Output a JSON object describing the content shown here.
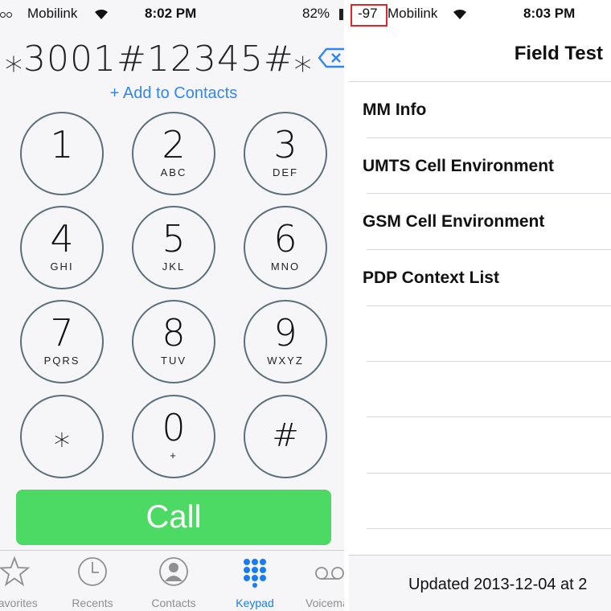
{
  "left_phone": {
    "status": {
      "carrier": "Mobilink",
      "time": "8:02 PM",
      "battery": "82%"
    },
    "dialed_number": "⁎3001#12345#⁎",
    "add_to_contacts": "+ Add to Contacts",
    "keys": [
      {
        "digit": "1",
        "letters": ""
      },
      {
        "digit": "2",
        "letters": "ABC"
      },
      {
        "digit": "3",
        "letters": "DEF"
      },
      {
        "digit": "4",
        "letters": "GHI"
      },
      {
        "digit": "5",
        "letters": "JKL"
      },
      {
        "digit": "6",
        "letters": "MNO"
      },
      {
        "digit": "7",
        "letters": "PQRS"
      },
      {
        "digit": "8",
        "letters": "TUV"
      },
      {
        "digit": "9",
        "letters": "WXYZ"
      },
      {
        "digit": "⁎",
        "letters": ""
      },
      {
        "digit": "0",
        "letters": "+"
      },
      {
        "digit": "#",
        "letters": ""
      }
    ],
    "call_label": "Call",
    "tabs": [
      {
        "label": "Favorites",
        "icon": "star-icon"
      },
      {
        "label": "Recents",
        "icon": "clock-icon"
      },
      {
        "label": "Contacts",
        "icon": "person-icon"
      },
      {
        "label": "Keypad",
        "icon": "keypad-icon",
        "active": true
      },
      {
        "label": "Voicemail",
        "icon": "voicemail-icon"
      }
    ],
    "colors": {
      "call_green": "#4cd964",
      "accent_blue": "#2f86f6"
    }
  },
  "right_phone": {
    "status": {
      "signal_dbm": "-97",
      "carrier": "Mobilink",
      "time": "8:03 PM"
    },
    "title": "Field Test",
    "items": [
      "MM Info",
      "UMTS Cell Environment",
      "GSM Cell Environment",
      "PDP Context List"
    ],
    "footer": "Updated 2013-12-04 at 2",
    "colors": {
      "highlight": "#e3242b"
    }
  }
}
